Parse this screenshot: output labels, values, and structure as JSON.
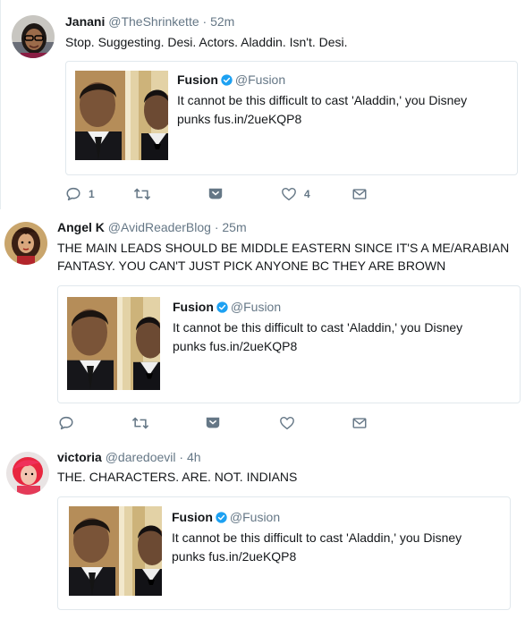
{
  "tweets": [
    {
      "name": "Janani",
      "handle": "@TheShrinkette",
      "time": "52m",
      "text": "Stop. Suggesting. Desi. Actors. Aladdin. Isn't. Desi.",
      "card": {
        "name": "Fusion",
        "handle": "@Fusion",
        "text": "It cannot be this difficult to cast 'Aladdin,' you Disney punks fus.in/2ueKQP8"
      },
      "reply_count": "1",
      "like_count": "4"
    },
    {
      "name": "Angel K",
      "handle": "@AvidReaderBlog",
      "time": "25m",
      "text": "THE MAIN LEADS SHOULD BE MIDDLE EASTERN SINCE IT'S A ME/ARABIAN FANTASY. YOU CAN'T JUST PICK ANYONE BC THEY ARE BROWN",
      "card": {
        "name": "Fusion",
        "handle": "@Fusion",
        "text": "It cannot be this difficult to cast 'Aladdin,' you Disney punks fus.in/2ueKQP8"
      }
    },
    {
      "name": "victoria",
      "handle": "@daredoevil",
      "time": "4h",
      "text": "THE. CHARACTERS. ARE. NOT. INDIANS",
      "card": {
        "name": "Fusion",
        "handle": "@Fusion",
        "text": "It cannot be this difficult to cast 'Aladdin,' you Disney punks fus.in/2ueKQP8"
      }
    }
  ],
  "separator": "·",
  "colors": {
    "verified": "#1da1f2",
    "secondary_text": "#657786",
    "border": "#e6ecf0"
  },
  "icons": [
    "reply-icon",
    "retweet-icon",
    "direct-message-icon",
    "like-icon",
    "envelope-icon",
    "verified-icon"
  ]
}
